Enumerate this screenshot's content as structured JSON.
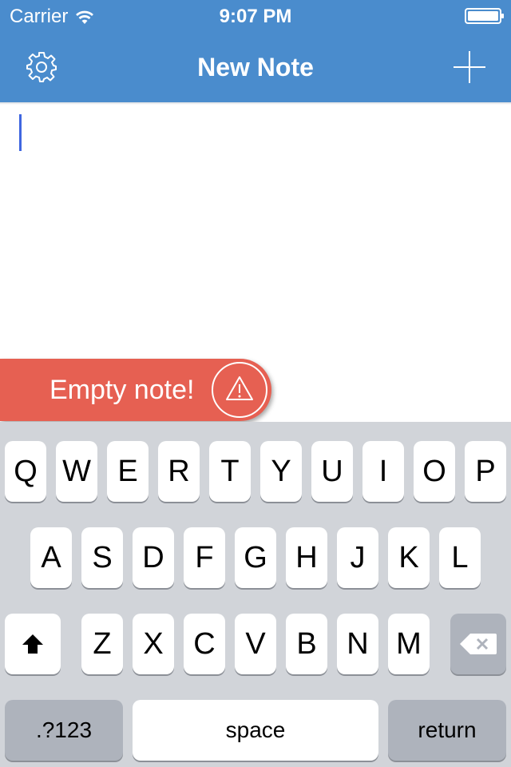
{
  "status_bar": {
    "carrier": "Carrier",
    "time": "9:07 PM"
  },
  "nav_bar": {
    "title": "New Note",
    "left_icon": "gear-icon",
    "right_icon": "plus-icon"
  },
  "editor": {
    "value": "",
    "placeholder": ""
  },
  "toast": {
    "message": "Empty note!",
    "icon": "warning-icon"
  },
  "keyboard": {
    "row1": [
      "Q",
      "W",
      "E",
      "R",
      "T",
      "Y",
      "U",
      "I",
      "O",
      "P"
    ],
    "row2": [
      "A",
      "S",
      "D",
      "F",
      "G",
      "H",
      "J",
      "K",
      "L"
    ],
    "row3": [
      "Z",
      "X",
      "C",
      "V",
      "B",
      "N",
      "M"
    ],
    "numbers_label": ".?123",
    "space_label": "space",
    "return_label": "return",
    "shift_icon": "shift-icon",
    "backspace_icon": "backspace-icon"
  },
  "colors": {
    "header": "#4a8ccd",
    "toast": "#e66052",
    "keyboard_bg": "#d1d4d9",
    "cursor": "#3f66e0"
  }
}
